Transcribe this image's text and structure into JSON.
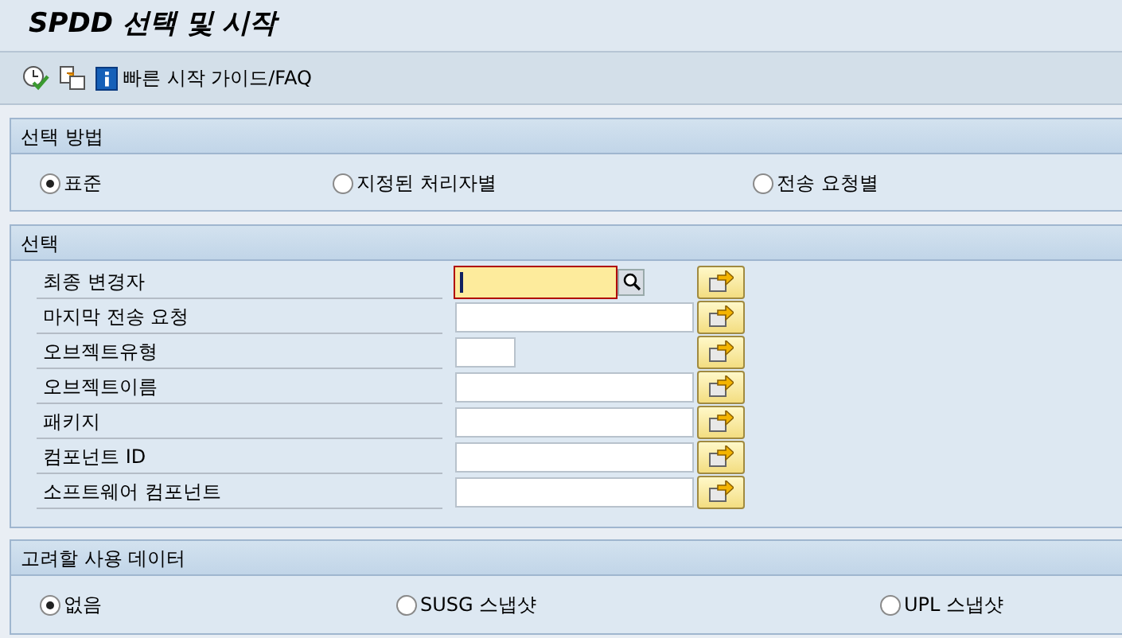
{
  "window": {
    "title": "SPDD 선택 및 시작"
  },
  "toolbar": {
    "link": "빠른 시작 가이드/FAQ"
  },
  "method_group": {
    "title": "선택 방법",
    "options": [
      {
        "label": "표준",
        "selected": true
      },
      {
        "label": "지정된 처리자별",
        "selected": false
      },
      {
        "label": "전송 요청별",
        "selected": false
      }
    ]
  },
  "selection_group": {
    "title": "선택",
    "fields": [
      {
        "label": "최종 변경자",
        "kind": "lookup",
        "focused": true
      },
      {
        "label": "마지막 전송 요청",
        "kind": "long",
        "focused": false
      },
      {
        "label": "오브젝트유형",
        "kind": "short",
        "focused": false
      },
      {
        "label": "오브젝트이름",
        "kind": "long",
        "focused": false
      },
      {
        "label": "패키지",
        "kind": "long",
        "focused": false
      },
      {
        "label": "컴포넌트 ID",
        "kind": "long",
        "focused": false
      },
      {
        "label": "소프트웨어 컴포넌트",
        "kind": "long",
        "focused": false
      }
    ]
  },
  "usage_group": {
    "title": "고려할 사용 데이터",
    "options": [
      {
        "label": "없음",
        "selected": true
      },
      {
        "label": "SUSG 스냅샷",
        "selected": false
      },
      {
        "label": "UPL 스냅샷",
        "selected": false
      }
    ]
  }
}
